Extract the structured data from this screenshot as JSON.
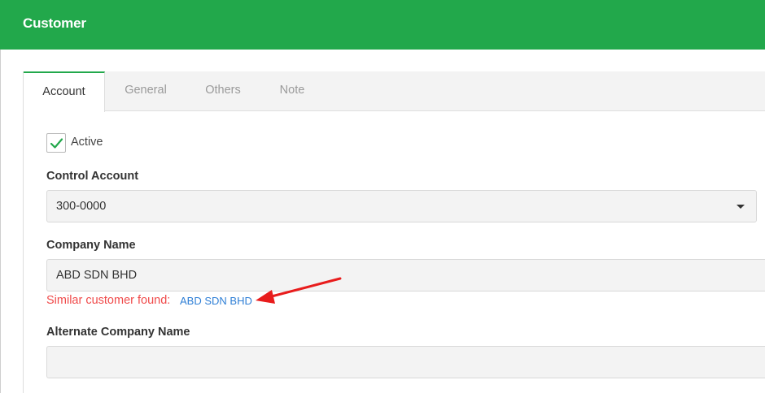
{
  "window": {
    "title": "Customer"
  },
  "tabs": [
    {
      "label": "Account",
      "active": true
    },
    {
      "label": "General",
      "active": false
    },
    {
      "label": "Others",
      "active": false
    },
    {
      "label": "Note",
      "active": false
    }
  ],
  "form": {
    "active": {
      "label": "Active",
      "checked": true
    },
    "control_account": {
      "label": "Control Account",
      "value": "300-0000"
    },
    "company_name": {
      "label": "Company Name",
      "value": "ABD SDN BHD"
    },
    "similar": {
      "text": "Similar customer found:",
      "link": "ABD SDN BHD"
    },
    "alternate_company_name": {
      "label": "Alternate Company Name",
      "value": ""
    }
  },
  "colors": {
    "header": "#22a84b",
    "warning": "#f04a4a",
    "link": "#2f7fd6",
    "annotation_arrow": "#e81c1c"
  }
}
